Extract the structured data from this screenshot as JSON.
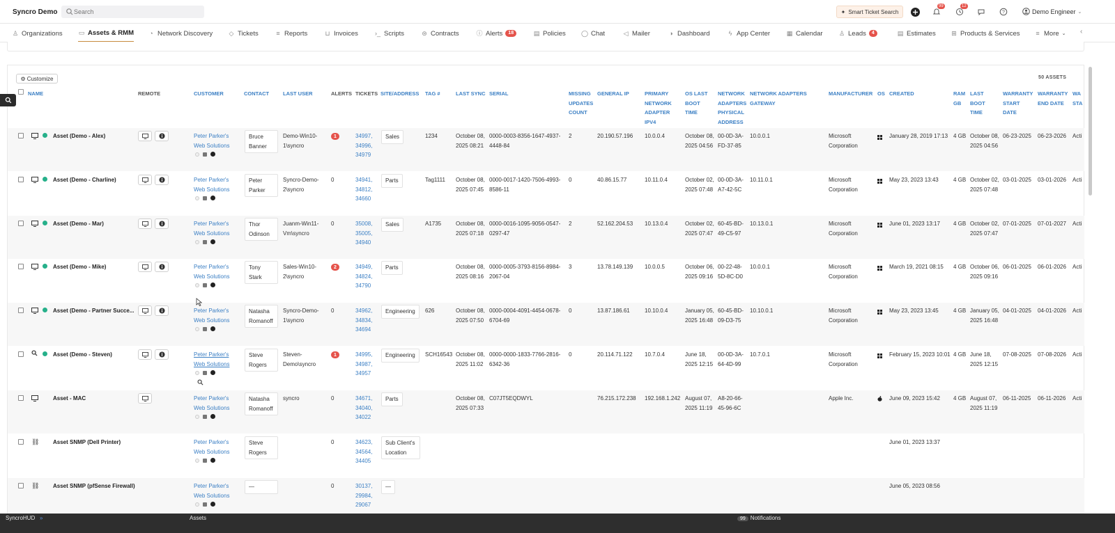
{
  "app": {
    "title": "Syncro Demo"
  },
  "search": {
    "placeholder": "Search"
  },
  "topbar": {
    "smart_ticket_search": "Smart Ticket Search",
    "notifications_badge": "99",
    "timer_badge": "12",
    "user": "Demo Engineer"
  },
  "nav": {
    "tabs": [
      {
        "label": "Organizations",
        "icon": "person-icon"
      },
      {
        "label": "Assets & RMM",
        "icon": "monitor-icon",
        "active": true
      },
      {
        "label": "Network Discovery",
        "icon": "radar-icon"
      },
      {
        "label": "Tickets",
        "icon": "tag-icon"
      },
      {
        "label": "Reports",
        "icon": "bar-chart-icon"
      },
      {
        "label": "Invoices",
        "icon": "cart-icon"
      },
      {
        "label": "Scripts",
        "icon": "terminal-icon"
      },
      {
        "label": "Contracts",
        "icon": "handshake-icon"
      },
      {
        "label": "Alerts",
        "icon": "alert-circle-icon",
        "badge": "18"
      },
      {
        "label": "Policies",
        "icon": "document-icon"
      },
      {
        "label": "Chat",
        "icon": "chat-icon"
      },
      {
        "label": "Mailer",
        "icon": "megaphone-icon"
      },
      {
        "label": "Dashboard",
        "icon": "gauge-icon"
      },
      {
        "label": "App Center",
        "icon": "bolt-icon"
      },
      {
        "label": "Calendar",
        "icon": "calendar-icon"
      },
      {
        "label": "Leads",
        "icon": "add-person-icon",
        "badge": "4"
      },
      {
        "label": "Estimates",
        "icon": "clipboard-icon"
      },
      {
        "label": "Products & Services",
        "icon": "grid-icon"
      },
      {
        "label": "More",
        "icon": "menu-icon"
      }
    ]
  },
  "grid": {
    "customize_label": "Customize",
    "count_label": "50 ASSETS",
    "headers": {
      "name": "NAME",
      "remote": "REMOTE",
      "customer": "CUSTOMER",
      "contact": "CONTACT",
      "last_user": "LAST USER",
      "alerts": "ALERTS",
      "tickets": "TICKETS",
      "site": "SITE/ADDRESS",
      "tag": "TAG #",
      "last_sync": "LAST SYNC",
      "serial": "SERIAL",
      "missing_updates": "MISSING UPDATES COUNT",
      "general_ip": "GENERAL IP",
      "primary_adapter": "PRIMARY NETWORK ADAPTER IPV4",
      "os_last_boot": "OS LAST BOOT TIME",
      "phys_addr": "NETWORK ADAPTERS PHYSICAL ADDRESS",
      "gateway": "NETWORK ADAPTERS GATEWAY",
      "manufacturer": "MANUFACTURER",
      "os": "OS",
      "created": "CREATED",
      "ram": "RAM GB",
      "last_boot": "LAST BOOT TIME",
      "warranty_start": "WARRANTY START DATE",
      "warranty_end": "WARRANTY END DATE",
      "warranty_status": "WA STA"
    },
    "rows": [
      {
        "name": "Asset (Demo - Alex)",
        "customer": "Peter Parker's Web Solutions",
        "contact": "Bruce Banner",
        "last_user": "Demo-Win10-1\\syncro",
        "alerts": "1",
        "tickets": "34997, 34996, 34979",
        "site": "Sales",
        "tag": "1234",
        "last_sync": "October 08, 2025 08:21",
        "serial": "0000-0003-8356-1647-4937-4448-84",
        "missing": "2",
        "general_ip": "20.190.57.196",
        "primary_ip": "10.0.0.4",
        "os_boot": "October 08, 2025 04:56",
        "phys": "00-0D-3A-FD-37-85",
        "gateway": "10.0.0.1",
        "manufacturer": "Microsoft Corporation",
        "os": "windows",
        "created": "January 28, 2019 17:13",
        "ram": "4 GB",
        "last_boot": "October 08, 2025 04:56",
        "w_start": "06-23-2025",
        "w_end": "06-23-2026",
        "w_status": "Acti"
      },
      {
        "name": "Asset (Demo - Charline)",
        "customer": "Peter Parker's Web Solutions",
        "contact": "Peter Parker",
        "last_user": "Syncro-Demo-2\\syncro",
        "alerts": "0",
        "tickets": "34941, 34812, 34660",
        "site": "Parts",
        "tag": "Tag1111",
        "last_sync": "October 08, 2025 07:45",
        "serial": "0000-0017-1420-7506-4993-8586-11",
        "missing": "0",
        "general_ip": "40.86.15.77",
        "primary_ip": "10.11.0.4",
        "os_boot": "October 02, 2025 07:48",
        "phys": "00-0D-3A-A7-42-5C",
        "gateway": "10.11.0.1",
        "manufacturer": "Microsoft Corporation",
        "os": "windows",
        "created": "May 23, 2023 13:43",
        "ram": "4 GB",
        "last_boot": "October 02, 2025 07:48",
        "w_start": "03-01-2025",
        "w_end": "03-01-2026",
        "w_status": "Acti"
      },
      {
        "name": "Asset (Demo - Mar)",
        "customer": "Peter Parker's Web Solutions",
        "contact": "Thor Odinson",
        "last_user": "Juanm-Win11-Vm\\syncro",
        "alerts": "0",
        "tickets": "35008, 35005, 34940",
        "site": "Sales",
        "tag": "A1735",
        "last_sync": "October 08, 2025 07:18",
        "serial": "0000-0016-1095-9056-0547-0297-47",
        "missing": "2",
        "general_ip": "52.162.204.53",
        "primary_ip": "10.13.0.4",
        "os_boot": "October 02, 2025 07:47",
        "phys": "60-45-BD-49-C5-97",
        "gateway": "10.13.0.1",
        "manufacturer": "Microsoft Corporation",
        "os": "windows",
        "created": "June 01, 2023 13:17",
        "ram": "4 GB",
        "last_boot": "October 02, 2025 07:47",
        "w_start": "07-01-2025",
        "w_end": "07-01-2027",
        "w_status": "Acti"
      },
      {
        "name": "Asset (Demo - Mike)",
        "customer": "Peter Parker's Web Solutions",
        "contact": "Tony Stark",
        "last_user": "Sales-Win10-2\\syncro",
        "alerts": "2",
        "tickets": "34949, 34824, 34790",
        "site": "Parts",
        "tag": "",
        "last_sync": "October 08, 2025 08:16",
        "serial": "0000-0005-3793-8156-8984-2067-04",
        "missing": "3",
        "general_ip": "13.78.149.139",
        "primary_ip": "10.0.0.5",
        "os_boot": "October 06, 2025 09:16",
        "phys": "00-22-48-5D-8C-D0",
        "gateway": "10.0.0.1",
        "manufacturer": "Microsoft Corporation",
        "os": "windows",
        "created": "March 19, 2021 08:15",
        "ram": "4 GB",
        "last_boot": "October 06, 2025 09:16",
        "w_start": "06-01-2025",
        "w_end": "06-01-2026",
        "w_status": "Acti"
      },
      {
        "name": "Asset (Demo - Partner Succe...",
        "customer": "Peter Parker's Web Solutions",
        "contact": "Natasha Romanoff",
        "last_user": "Syncro-Demo-1\\syncro",
        "alerts": "0",
        "tickets": "34962, 34834, 34694",
        "site": "Engineering",
        "tag": "626",
        "last_sync": "October 08, 2025 07:50",
        "serial": "0000-0004-4091-4454-0678-6704-69",
        "missing": "0",
        "general_ip": "13.87.186.61",
        "primary_ip": "10.10.0.4",
        "os_boot": "January 05, 2025 16:48",
        "phys": "60-45-BD-09-D3-75",
        "gateway": "10.10.0.1",
        "manufacturer": "Microsoft Corporation",
        "os": "windows",
        "created": "May 23, 2023 13:45",
        "ram": "4 GB",
        "last_boot": "January 05, 2025 16:48",
        "w_start": "04-01-2025",
        "w_end": "04-01-2026",
        "w_status": "Acti"
      },
      {
        "name": "Asset (Demo - Steven)",
        "customer": "Peter Parker's Web Solutions",
        "contact": "Steve Rogers",
        "last_user": "Steven-Demo\\syncro",
        "alerts": "1",
        "tickets": "34995, 34987, 34957",
        "site": "Engineering",
        "tag": "SCH16543",
        "last_sync": "October 08, 2025 11:02",
        "serial": "0000-0000-1833-7766-2816-6342-36",
        "missing": "0",
        "general_ip": "20.114.71.122",
        "primary_ip": "10.7.0.4",
        "os_boot": "June 18, 2025 12:15",
        "phys": "00-0D-3A-64-4D-99",
        "gateway": "10.7.0.1",
        "manufacturer": "Microsoft Corporation",
        "os": "windows",
        "created": "February 15, 2023 10:01",
        "ram": "4 GB",
        "last_boot": "June 18, 2025 12:15",
        "w_start": "07-08-2025",
        "w_end": "07-08-2026",
        "w_status": "Acti"
      },
      {
        "name": "Asset - MAC",
        "customer": "Peter Parker's Web Solutions",
        "contact": "Natasha Romanoff",
        "last_user": "syncro",
        "alerts": "0",
        "tickets": "34671, 34040, 34022",
        "site": "Parts",
        "tag": "",
        "last_sync": "October 08, 2025 07:33",
        "serial": "C07JT5EQDWYL",
        "missing": "",
        "general_ip": "76.215.172.238",
        "primary_ip": "192.168.1.242",
        "os_boot": "August 07, 2025 11:19",
        "phys": "A8-20-66-45-96-6C",
        "gateway": "",
        "manufacturer": "Apple Inc.",
        "os": "apple",
        "created": "June 09, 2023 15:42",
        "ram": "4 GB",
        "last_boot": "August 07, 2025 11:19",
        "w_start": "06-11-2025",
        "w_end": "06-11-2026",
        "w_status": "Acti"
      },
      {
        "name": "Asset SNMP (Dell Printer)",
        "customer": "Peter Parker's Web Solutions",
        "contact": "Steve Rogers",
        "last_user": "",
        "alerts": "0",
        "tickets": "34623, 34564, 34405",
        "site": "Sub Client's Location",
        "tag": "",
        "last_sync": "",
        "serial": "",
        "missing": "",
        "general_ip": "",
        "primary_ip": "",
        "os_boot": "",
        "phys": "",
        "gateway": "",
        "manufacturer": "",
        "os": "",
        "created": "June 01, 2023 13:37",
        "ram": "",
        "last_boot": "",
        "w_start": "",
        "w_end": "",
        "w_status": ""
      },
      {
        "name": "Asset SNMP (pfSense Firewall)",
        "customer": "Peter Parker's Web Solutions",
        "contact": "—",
        "last_user": "",
        "alerts": "0",
        "tickets": "30137, 29984, 29067",
        "site": "—",
        "tag": "",
        "last_sync": "",
        "serial": "",
        "missing": "",
        "general_ip": "",
        "primary_ip": "",
        "os_boot": "",
        "phys": "",
        "gateway": "",
        "manufacturer": "",
        "os": "",
        "created": "June 05, 2023 08:56",
        "ram": "",
        "last_boot": "",
        "w_start": "",
        "w_end": "",
        "w_status": ""
      }
    ]
  },
  "bottom": {
    "hud": "SyncroHUD",
    "section": "Assets",
    "notif_count": "99",
    "notif_label": "Notifications"
  },
  "colors": {
    "accent": "#c78a3e",
    "link": "#3b7fc4",
    "badge": "#e5534b",
    "online": "#26b08a"
  }
}
